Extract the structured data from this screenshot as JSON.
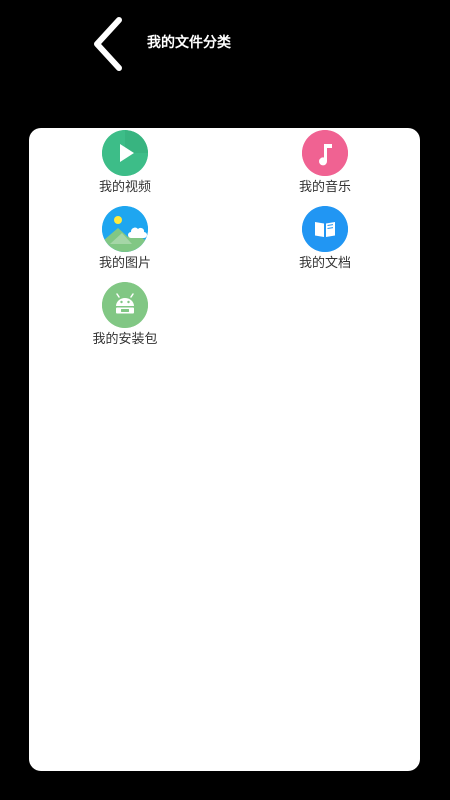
{
  "header": {
    "title": "我的文件分类",
    "back_icon": "chevron-left-icon"
  },
  "categories": [
    {
      "label": "我的视频",
      "icon": "play-icon",
      "color": "#3dbd88"
    },
    {
      "label": "我的音乐",
      "icon": "music-note-icon",
      "color": "#f06292"
    },
    {
      "label": "我的图片",
      "icon": "landscape-image-icon",
      "color": "#1ea6f0"
    },
    {
      "label": "我的文档",
      "icon": "book-icon",
      "color": "#2196f3"
    },
    {
      "label": "我的安装包",
      "icon": "android-apk-icon",
      "color": "#81c784"
    }
  ],
  "colors": {
    "background": "#000000",
    "card": "#ffffff",
    "label_text": "#333333"
  }
}
